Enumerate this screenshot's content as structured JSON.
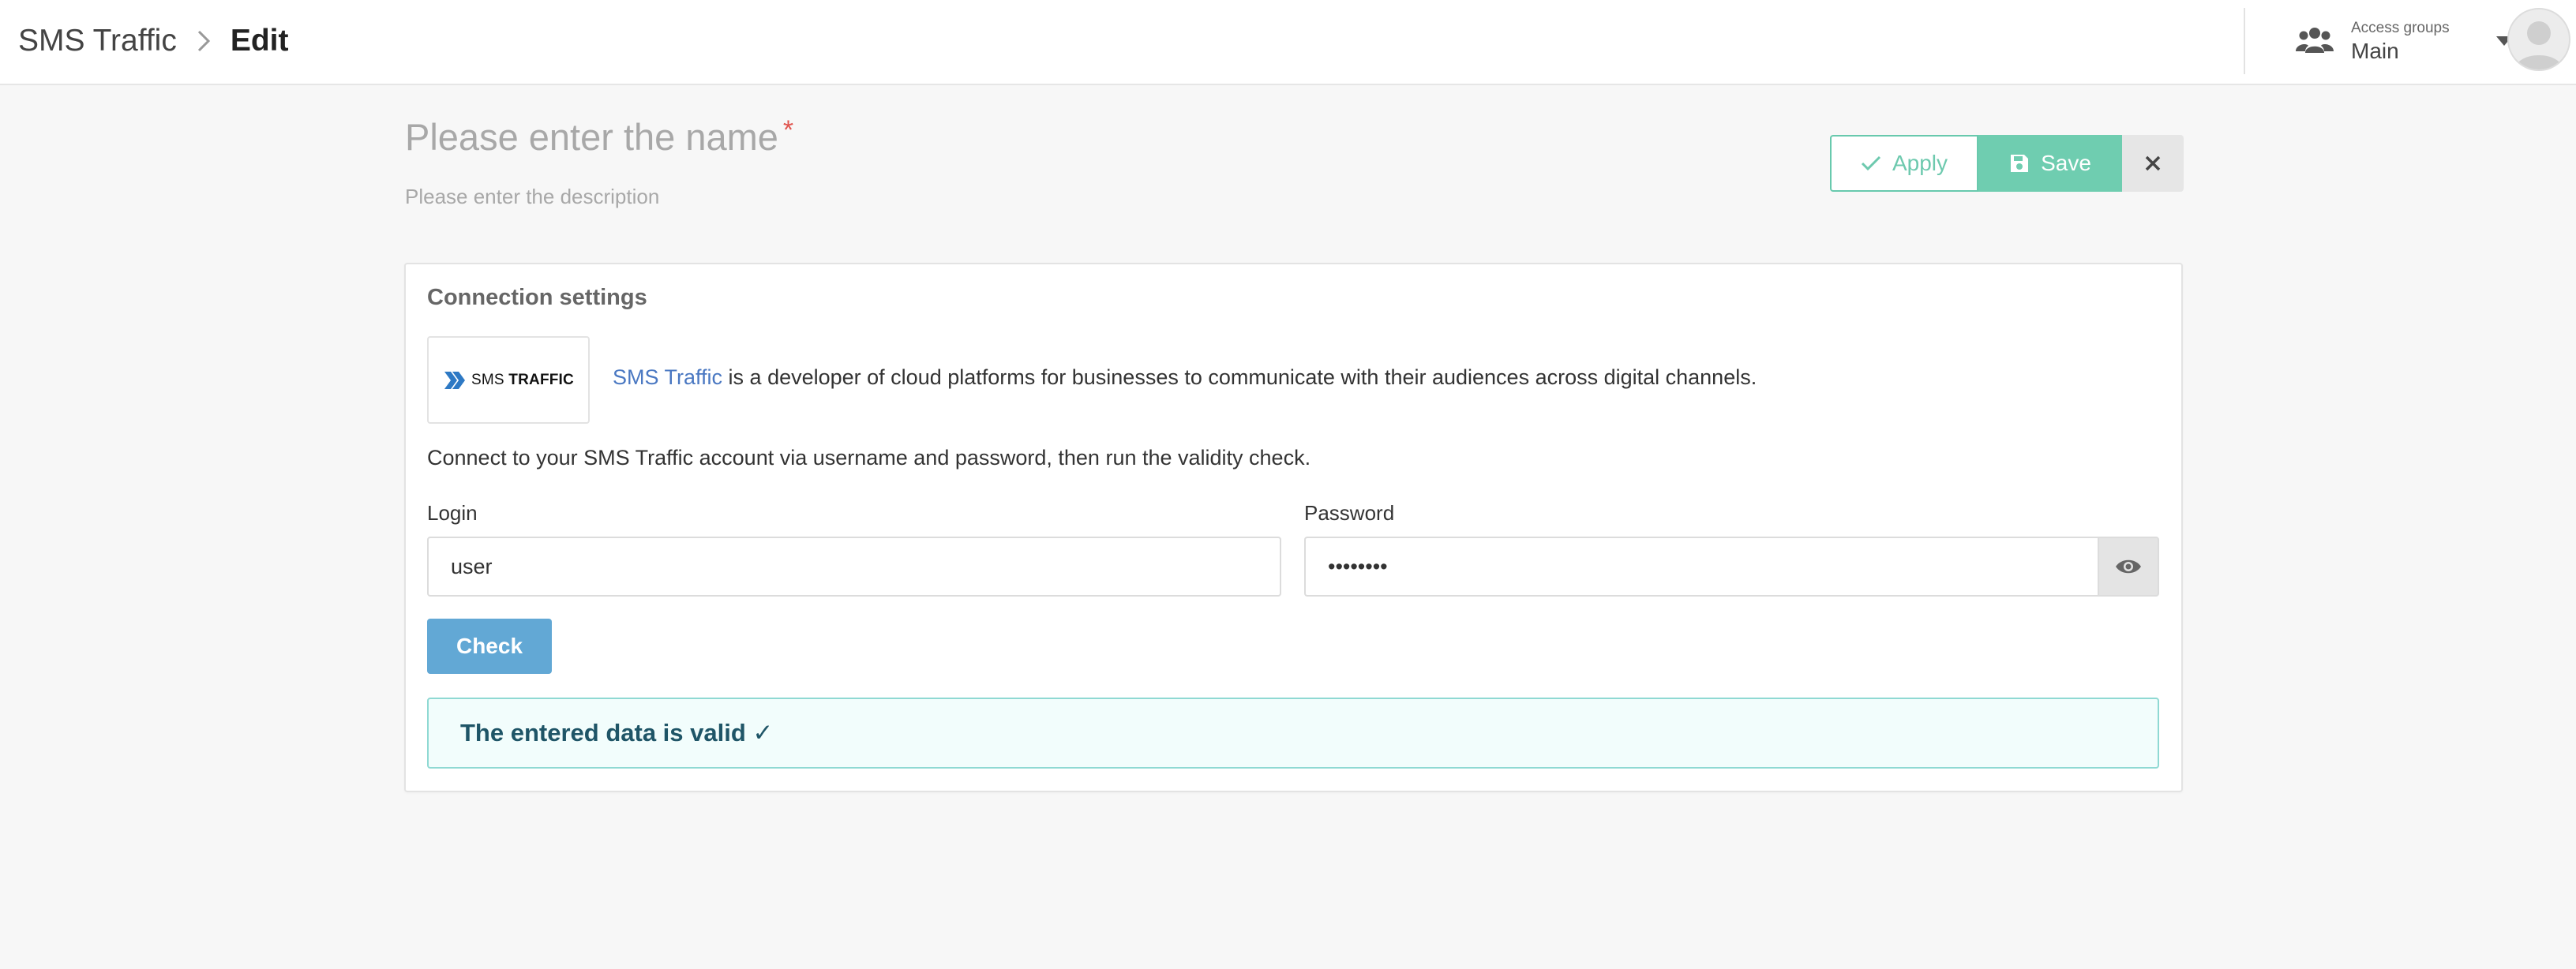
{
  "header": {
    "breadcrumb_parent": "SMS Traffic",
    "breadcrumb_current": "Edit",
    "access_groups_label": "Access groups",
    "access_groups_value": "Main"
  },
  "form": {
    "name_placeholder": "Please enter the name",
    "required_mark": "*",
    "description_placeholder": "Please enter the description",
    "apply_label": "Apply",
    "save_label": "Save"
  },
  "connection": {
    "title": "Connection settings",
    "logo_text_light": "SMS",
    "logo_text_bold": "TRAFFIC",
    "provider_link": "SMS Traffic",
    "provider_description": " is a developer of cloud platforms for businesses to communicate with their audiences across digital channels.",
    "instructions": "Connect to your SMS Traffic account via username and password, then run the validity check.",
    "login_label": "Login",
    "login_value": "user",
    "password_label": "Password",
    "password_value": "••••••••",
    "check_label": "Check",
    "validation_message": "The entered data is valid ✓"
  },
  "colors": {
    "accent_green": "#6fcdb0",
    "check_blue": "#62a8d5",
    "link_blue": "#4a78c2",
    "valid_border": "#8fd9d3"
  },
  "icons": {
    "breadcrumb_separator": "chevron-right-icon",
    "access_groups": "users-icon",
    "dropdown": "caret-down-icon",
    "apply": "check-icon",
    "save": "floppy-disk-icon",
    "close": "close-icon",
    "show_password": "eye-icon",
    "avatar": "user-avatar-icon"
  }
}
